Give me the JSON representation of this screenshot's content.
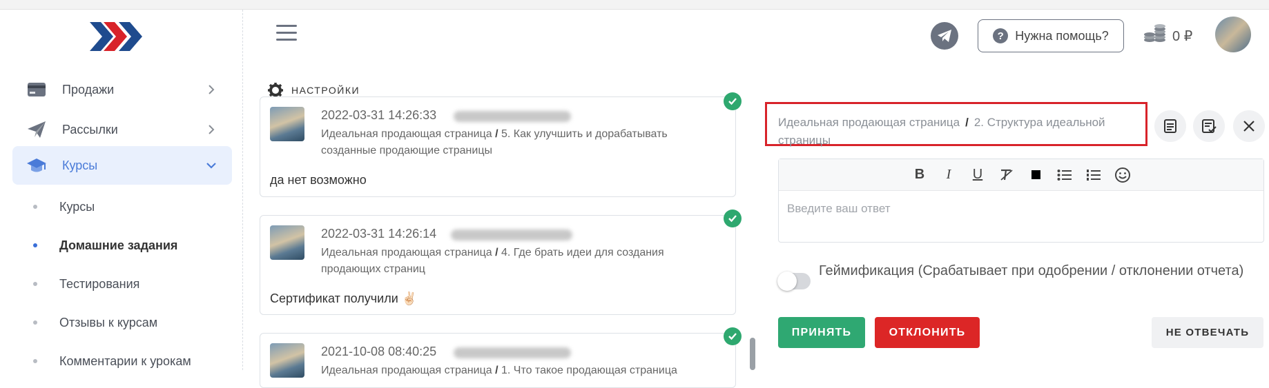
{
  "header": {
    "help_label": "Нужна помощь?",
    "balance": "0 ₽"
  },
  "sidebar": {
    "items": [
      {
        "label": "Продажи",
        "icon": "credit-card-icon"
      },
      {
        "label": "Рассылки",
        "icon": "paper-plane-icon"
      },
      {
        "label": "Курсы",
        "icon": "graduation-cap-icon"
      }
    ],
    "subitems": [
      {
        "label": "Курсы"
      },
      {
        "label": "Домашние задания"
      },
      {
        "label": "Тестирования"
      },
      {
        "label": "Отзывы к курсам"
      },
      {
        "label": "Комментарии к урокам"
      }
    ]
  },
  "settings_label": "НАСТРОЙКИ",
  "reports": [
    {
      "date": "2022-03-31 14:26:33",
      "course": "Идеальная продающая страница",
      "lesson": "5. Как улучшить и дорабатывать созданные продающие страницы",
      "message": "да нет возможно"
    },
    {
      "date": "2022-03-31 14:26:14",
      "course": "Идеальная продающая страница",
      "lesson": "4. Где брать идеи для создания продающих страниц",
      "message": "Сертификат получили ✌🏻"
    },
    {
      "date": "2021-10-08 08:40:25",
      "course": "Идеальная продающая страница",
      "lesson": "1. Что такое продающая страница"
    }
  ],
  "detail": {
    "breadcrumb_course": "Идеальная продающая страница",
    "breadcrumb_sep": "/",
    "breadcrumb_lesson": "2. Структура идеальной страницы",
    "answer_placeholder": "Введите ваш ответ",
    "gamification_label": "Геймификация (Срабатывает при одобрении / отклонении отчета)",
    "accept_label": "ПРИНЯТЬ",
    "reject_label": "ОТКЛОНИТЬ",
    "skip_label": "НЕ ОТВЕЧАТЬ"
  },
  "colors": {
    "accent": "#4a7bd8",
    "accept": "#2fa872",
    "reject": "#dc2626",
    "highlight_box": "#d8232a"
  }
}
